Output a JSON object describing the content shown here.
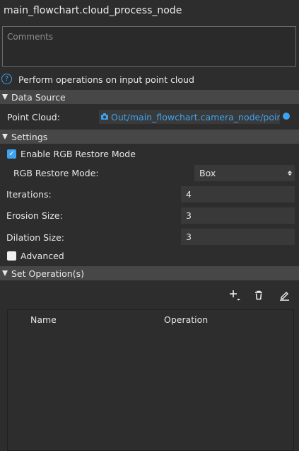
{
  "title": "main_flowchart.cloud_process_node",
  "comments": {
    "placeholder": "Comments",
    "value": ""
  },
  "description": "Perform operations on input point cloud",
  "sections": {
    "data_source": "Data Source",
    "settings": "Settings",
    "set_operations": "Set Operation(s)"
  },
  "data_source": {
    "point_cloud_label": "Point Cloud:",
    "point_cloud_link": "Out/main_flowchart.camera_node/pointC",
    "link_color": "#3da2ef"
  },
  "settings": {
    "enable_rgb_label": "Enable RGB Restore Mode",
    "enable_rgb_checked": true,
    "rgb_mode_label": "RGB Restore Mode:",
    "rgb_mode_value": "Box",
    "iterations_label": "Iterations:",
    "iterations_value": "4",
    "erosion_label": "Erosion Size:",
    "erosion_value": "3",
    "dilation_label": "Dilation Size:",
    "dilation_value": "3",
    "advanced_label": "Advanced",
    "advanced_checked": false
  },
  "operations_table": {
    "columns": [
      "Name",
      "Operation"
    ],
    "rows": []
  },
  "toolbar_icons": [
    "add-icon",
    "trash-icon",
    "edit-icon"
  ],
  "colors": {
    "accent": "#3da2ef",
    "section_header": "#474747",
    "background": "#2d2d2d"
  }
}
